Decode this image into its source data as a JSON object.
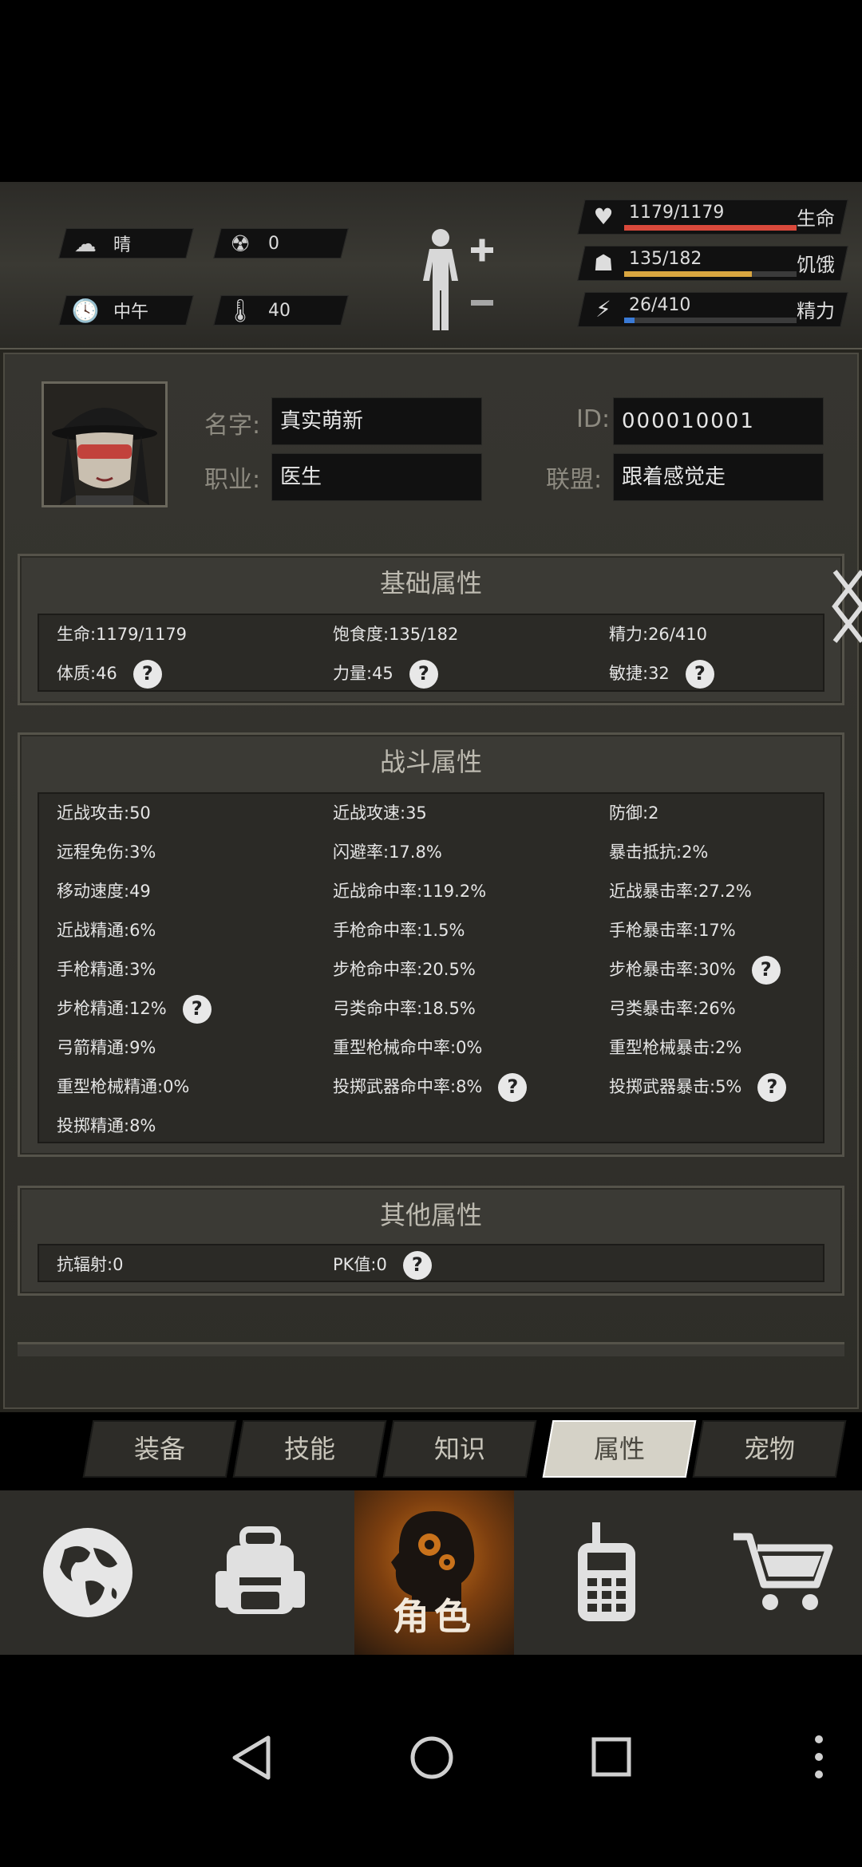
{
  "status": {
    "weather": "晴",
    "radiation": "0",
    "time": "中午",
    "temperature": "40",
    "vitals": [
      {
        "label": "生命",
        "value": "1179/1179",
        "fill": 1.0,
        "color": "#d9493b"
      },
      {
        "label": "饥饿",
        "value": "135/182",
        "fill": 0.74,
        "color": "#d9a640"
      },
      {
        "label": "精力",
        "value": "26/410",
        "fill": 0.06,
        "color": "#3a7ad6"
      }
    ]
  },
  "profile": {
    "name_label": "名字:",
    "name": "真实萌新",
    "id_label": "ID:",
    "id": "000010001",
    "job_label": "职业:",
    "job": "医生",
    "alliance_label": "联盟:",
    "alliance": "跟着感觉走"
  },
  "sections": {
    "basic": {
      "title": "基础属性",
      "rows": [
        [
          {
            "text": "生命:1179/1179"
          },
          {
            "text": "饱食度:135/182"
          },
          {
            "text": "精力:26/410"
          }
        ],
        [
          {
            "text": "体质:46",
            "help": true
          },
          {
            "text": "力量:45",
            "help": true
          },
          {
            "text": "敏捷:32",
            "help": true
          }
        ]
      ]
    },
    "combat": {
      "title": "战斗属性",
      "rows": [
        [
          {
            "text": "近战攻击:50"
          },
          {
            "text": "近战攻速:35"
          },
          {
            "text": "防御:2"
          }
        ],
        [
          {
            "text": "远程免伤:3%"
          },
          {
            "text": "闪避率:17.8%"
          },
          {
            "text": "暴击抵抗:2%"
          }
        ],
        [
          {
            "text": "移动速度:49"
          },
          {
            "text": "近战命中率:119.2%"
          },
          {
            "text": "近战暴击率:27.2%"
          }
        ],
        [
          {
            "text": "近战精通:6%"
          },
          {
            "text": "手枪命中率:1.5%"
          },
          {
            "text": "手枪暴击率:17%"
          }
        ],
        [
          {
            "text": "手枪精通:3%"
          },
          {
            "text": "步枪命中率:20.5%"
          },
          {
            "text": "步枪暴击率:30%",
            "help": true
          }
        ],
        [
          {
            "text": "步枪精通:12%",
            "help": true
          },
          {
            "text": "弓类命中率:18.5%"
          },
          {
            "text": "弓类暴击率:26%"
          }
        ],
        [
          {
            "text": "弓箭精通:9%"
          },
          {
            "text": "重型枪械命中率:0%"
          },
          {
            "text": "重型枪械暴击:2%"
          }
        ],
        [
          {
            "text": "重型枪械精通:0%"
          },
          {
            "text": "投掷武器命中率:8%",
            "help": true
          },
          {
            "text": "投掷武器暴击:5%",
            "help": true
          }
        ],
        [
          {
            "text": "投掷精通:8%"
          }
        ]
      ]
    },
    "other": {
      "title": "其他属性",
      "rows": [
        [
          {
            "text": "抗辐射:0"
          },
          {
            "text": "PK值:0",
            "help": true
          }
        ]
      ]
    }
  },
  "tabs": [
    "装备",
    "技能",
    "知识",
    "属性",
    "宠物"
  ],
  "active_tab": 3,
  "bottom_nav": {
    "active_label": "角色",
    "items": [
      "world-map-icon",
      "backpack-icon",
      "character-icon",
      "walkie-talkie-icon",
      "shop-cart-icon"
    ]
  }
}
